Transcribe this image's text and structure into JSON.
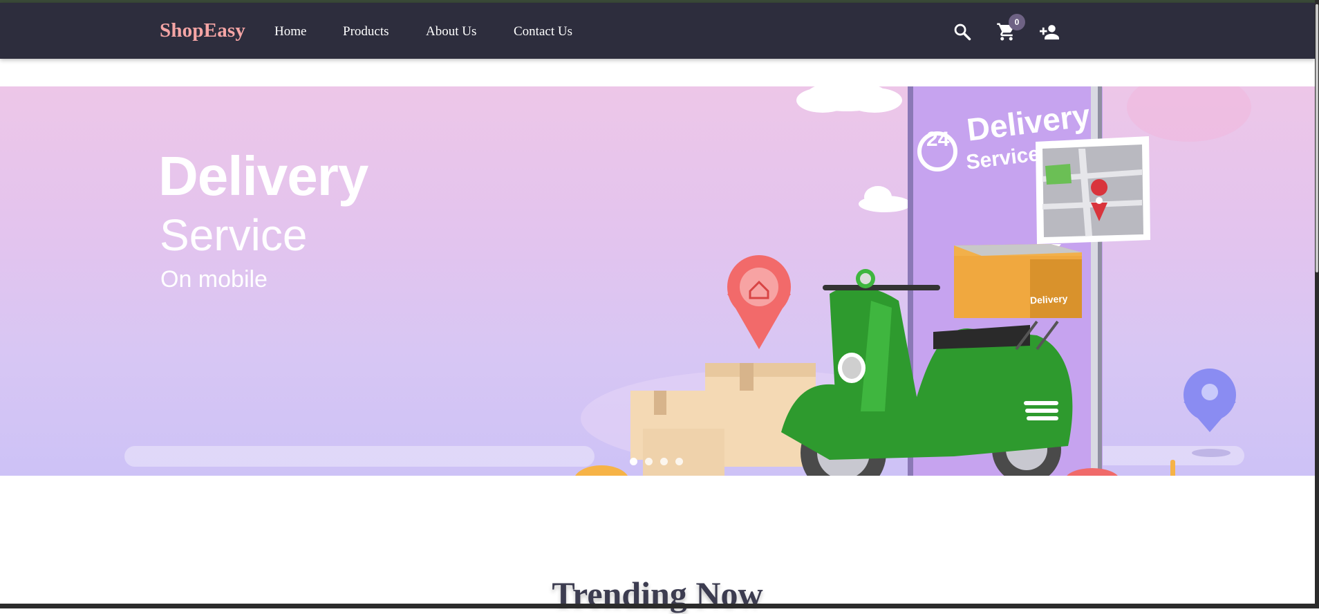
{
  "navbar": {
    "brand": "ShopEasy",
    "links": [
      {
        "label": "Home"
      },
      {
        "label": "Products"
      },
      {
        "label": "About Us"
      },
      {
        "label": "Contact Us"
      }
    ],
    "cart_count": "0",
    "icons": [
      "search-icon",
      "cart-icon",
      "add-user-icon"
    ]
  },
  "hero": {
    "title": "Delivery",
    "subtitle": "Service",
    "tagline": "On mobile",
    "phone_badge_number": "24",
    "phone_title": "Delivery",
    "phone_subtitle": "Service",
    "box_label": "Delivery",
    "slides_count": 4,
    "active_slide": 1
  },
  "section": {
    "title": "Trending Now"
  },
  "colors": {
    "navbar_bg": "#2d2d3d",
    "brand": "#f5a5a5",
    "badge": "#6e6284",
    "heading": "#3c3c50",
    "scooter": "#2e9a2e"
  }
}
